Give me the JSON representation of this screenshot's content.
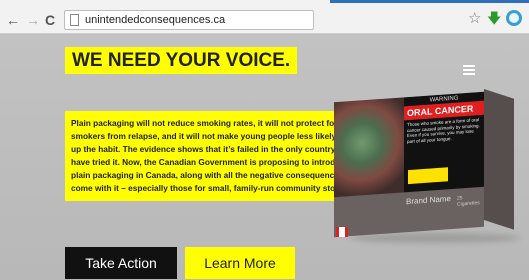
{
  "browser": {
    "url": "unintendedconsequences.ca",
    "icons": {
      "back": "arrow-left-icon",
      "forward": "arrow-right-icon",
      "reload": "reload-icon",
      "page": "page-icon",
      "star": "star-icon",
      "download": "download-icon",
      "extension": "extension-icon"
    }
  },
  "page": {
    "headline": "WE NEED YOUR VOICE.",
    "body": "Plain packaging will not reduce smoking rates, it will not protect former smokers from relapse, and it will not make young people less likely to take up the habit. The evidence shows that it’s failed in the only country to have tried it. Now, the Canadian Government is proposing to introduce plain packaging in Canada, along with all the negative consequences that come with it – especially those for small, family-run community stores.",
    "buttons": {
      "take_action": "Take Action",
      "learn_more": "Learn More"
    },
    "pack": {
      "warning_label": "WARNING",
      "warning_title": "ORAL CANCER",
      "warning_text": "Those who smoke are a form of oral cancer caused primarily by smoking. Even if you survive, you may lose part of all your tongue.",
      "brand": "Brand Name",
      "count": "25 Cigarettes"
    },
    "colors": {
      "accent": "#ffff00",
      "dark_button": "#111111",
      "background": "#bdbdbd"
    }
  }
}
